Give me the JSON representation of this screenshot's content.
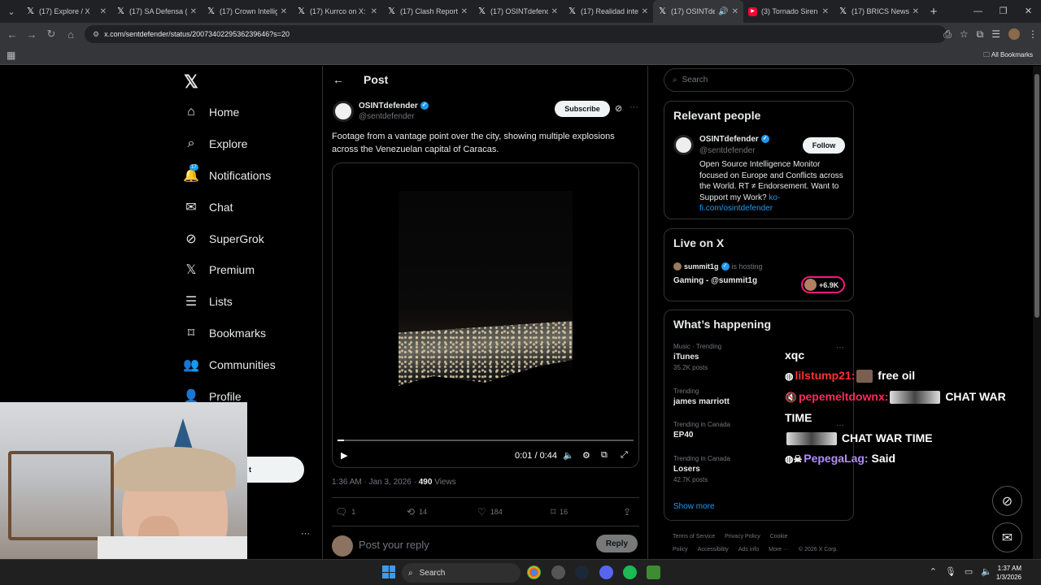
{
  "browser": {
    "tabs": [
      {
        "label": "(17) Explore / X",
        "favicon": "x-icon"
      },
      {
        "label": "(17) SA Defensa (",
        "favicon": "x-icon"
      },
      {
        "label": "(17) Crown Intellig",
        "favicon": "x-icon"
      },
      {
        "label": "(17) Kurrco on X:",
        "favicon": "x-icon"
      },
      {
        "label": "(17) Clash Report",
        "favicon": "x-icon"
      },
      {
        "label": "(17) OSINTdefend",
        "favicon": "x-icon"
      },
      {
        "label": "(17) Realidad inte",
        "favicon": "x-icon"
      },
      {
        "label": "(17) OSINTde",
        "favicon": "x-icon",
        "active": true
      },
      {
        "label": "(3) Tornado Siren",
        "favicon": "youtube-icon"
      },
      {
        "label": "(17) BRICS News o",
        "favicon": "x-icon"
      }
    ],
    "url": "x.com/sentdefender/status/2007340229536239646?s=20",
    "all_bookmarks": "All Bookmarks"
  },
  "nav": {
    "items": [
      {
        "label": "Home",
        "icon": "home-icon"
      },
      {
        "label": "Explore",
        "icon": "search-icon"
      },
      {
        "label": "Notifications",
        "icon": "bell-icon",
        "badge": "17"
      },
      {
        "label": "Chat",
        "icon": "mail-icon"
      },
      {
        "label": "SuperGrok",
        "icon": "grok-icon"
      },
      {
        "label": "Premium",
        "icon": "x-icon"
      },
      {
        "label": "Lists",
        "icon": "list-icon"
      },
      {
        "label": "Bookmarks",
        "icon": "bookmark-icon"
      },
      {
        "label": "Communities",
        "icon": "communities-icon"
      },
      {
        "label": "Profile",
        "icon": "profile-icon"
      }
    ],
    "post_button_partial": "t"
  },
  "post": {
    "header": "Post",
    "author_name": "OSINTdefender",
    "author_handle": "@sentdefender",
    "subscribe_label": "Subscribe",
    "text": "Footage from a vantage point over the city, showing multiple explosions across the Venezuelan capital of Caracas.",
    "video_time": "0:01 / 0:44",
    "video_progress": 0.023,
    "timestamp": "1:36 AM · Jan 3, 2026 · ",
    "views_count": "490",
    "views_label": " Views",
    "replies": "1",
    "reposts": "14",
    "likes": "184",
    "bookmarks": "16",
    "reply_placeholder": "Post your reply",
    "reply_button": "Reply"
  },
  "sidebar": {
    "search_placeholder": "Search",
    "relevant_title": "Relevant people",
    "person_name": "OSINTdefender",
    "person_handle": "@sentdefender",
    "follow_label": "Follow",
    "person_bio": "Open Source Intelligence Monitor focused on Europe and Conflicts across the World. RT ≠ Endorsement. Want to Support my Work? ",
    "person_link": "ko-fi.com/osintdefender",
    "live_title": "Live on X",
    "live_host": "summit1g",
    "live_hosting": "is hosting",
    "live_show": "Gaming - @summit1g",
    "live_count": "+6.9K",
    "happening_title": "What’s happening",
    "trends": [
      {
        "context": "Music · Trending",
        "name": "iTunes",
        "posts": "35.2K posts"
      },
      {
        "context": "Trending",
        "name": "james marriott",
        "posts": ""
      },
      {
        "context": "Trending in Canada",
        "name": "EP40",
        "posts": ""
      },
      {
        "context": "Trending in Canada",
        "name": "Losers",
        "posts": "42.7K posts"
      }
    ],
    "show_more": "Show more",
    "footer": [
      "Terms of Service",
      "Privacy Policy",
      "Cookie Policy",
      "Accessibility",
      "Ads info",
      "More ···",
      "© 2026 X Corp."
    ]
  },
  "chat": {
    "header": "xqc",
    "lines": [
      {
        "user": "lilstump21:",
        "msg": "free oil"
      },
      {
        "user": "pepemeltdownx:",
        "msg": "CHAT WAR TIME",
        "msg2": "CHAT WAR TIME"
      },
      {
        "user": "PepegaLag:",
        "msg": "Said"
      }
    ]
  },
  "taskbar": {
    "search_label": "Search",
    "time": "1:37 AM",
    "date": "1/3/2026"
  }
}
